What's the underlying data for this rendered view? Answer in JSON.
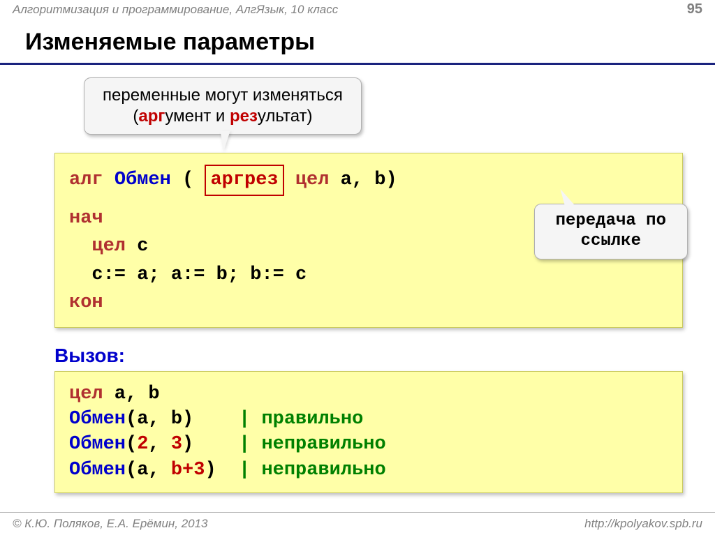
{
  "header": {
    "breadcrumb": "Алгоритмизация и программирование, АлгЯзык, 10 класс",
    "page_number": "95"
  },
  "title": "Изменяемые параметры",
  "callout_top": {
    "line1": "переменные могут изменяться",
    "line2_pre": "(",
    "line2_arg_hi": "арг",
    "line2_arg_rest": "умент и ",
    "line2_res_hi": "рез",
    "line2_res_rest": "ультат)"
  },
  "code1": {
    "alg": "алг",
    "name": "Обмен",
    "open": " ( ",
    "argrez": "аргрез",
    "after_box": " ",
    "type1": "цел",
    "params": " a, b)",
    "nach": "нач",
    "indent2": "  ",
    "type2": "цел",
    "cvar": " c",
    "swap_line": "  c:= a; a:= b; b:= c",
    "kon": "кон"
  },
  "callout_right": {
    "line1": "передача по",
    "line2": "ссылке"
  },
  "subhead": "Вызов:",
  "code2": {
    "l1_type": "цел",
    "l1_rest": " a, b",
    "l2_name": "Обмен",
    "l2_rest": "(a, b)    ",
    "l2_cmt": "| правильно",
    "l3_name": "Обмен",
    "l3_p": "(",
    "l3_a1": "2",
    "l3_c": ", ",
    "l3_a2": "3",
    "l3_rest": ")    ",
    "l3_cmt": "| неправильно",
    "l4_name": "Обмен",
    "l4_p": "(a, ",
    "l4_a2": "b+3",
    "l4_rest": ")  ",
    "l4_cmt": "| неправильно"
  },
  "footer": {
    "left": "© К.Ю. Поляков, Е.А. Ерёмин, 2013",
    "right": "http://kpolyakov.spb.ru"
  }
}
